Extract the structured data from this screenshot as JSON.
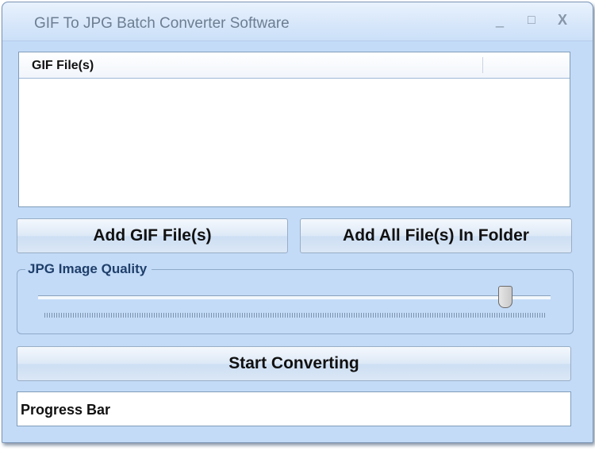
{
  "window": {
    "title": "GIF To JPG Batch Converter Software",
    "minimize": "_",
    "maximize": "□",
    "close": "X"
  },
  "file_list": {
    "columns": [
      "GIF File(s)",
      ""
    ],
    "rows": []
  },
  "buttons": {
    "add_files": "Add GIF File(s)",
    "add_folder": "Add All File(s) In Folder",
    "start": "Start Converting"
  },
  "quality": {
    "label": "JPG Image Quality",
    "value_percent": 91
  },
  "progress": {
    "label": "Progress Bar"
  }
}
